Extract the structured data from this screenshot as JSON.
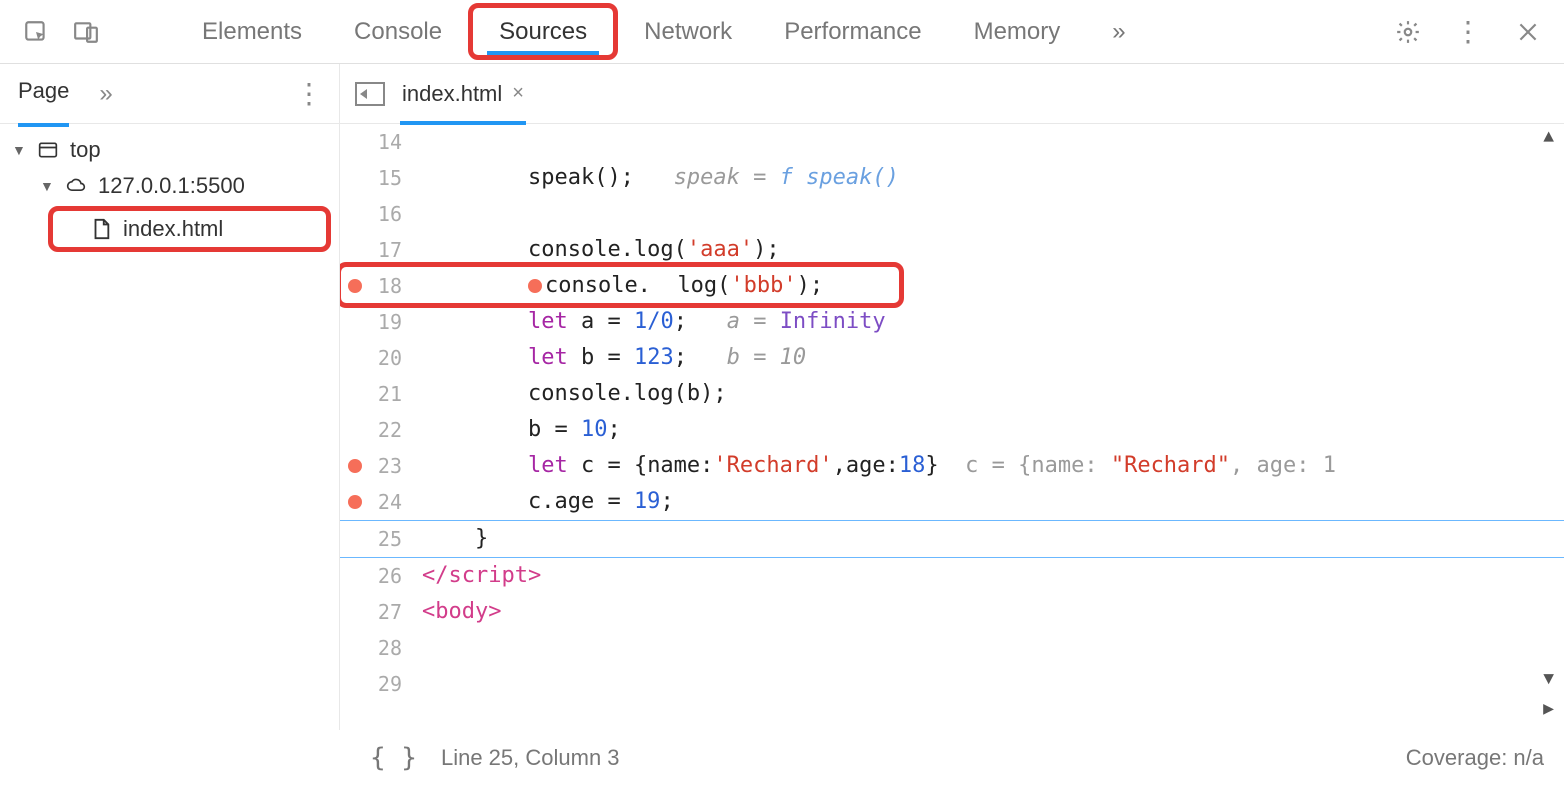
{
  "topTabs": {
    "elements": "Elements",
    "console": "Console",
    "sources": "Sources",
    "network": "Network",
    "performance": "Performance",
    "memory": "Memory",
    "more": "»"
  },
  "navigator": {
    "tab": "Page",
    "more": "»",
    "top": "top",
    "host": "127.0.0.1:5500",
    "file": "index.html"
  },
  "editor": {
    "tab": "index.html",
    "closeGlyph": "×",
    "lines": {
      "14": "14",
      "15": "15",
      "16": "16",
      "17": "17",
      "18": "18",
      "19": "19",
      "20": "20",
      "21": "21",
      "22": "22",
      "23": "23",
      "24": "24",
      "25": "25",
      "26": "26",
      "27": "27",
      "28": "28",
      "29": "29"
    },
    "code": {
      "l15_call": "speak();",
      "l15_hint_prefix": "speak = ",
      "l15_hint_fn": "f speak()",
      "l17": "console.log(",
      "l17_str": "'aaa'",
      "l17_end": ");",
      "l18a": "console.",
      "l18b": "log(",
      "l18_str": "'bbb'",
      "l18_end": ");",
      "l19_let": "let",
      "l19_a": " a = ",
      "l19_expr": "1/0",
      "l19_semi": ";",
      "l19_hint": "a = ",
      "l19_inf": "Infinity",
      "l20_let": "let",
      "l20_b": " b = ",
      "l20_num": "123",
      "l20_semi": ";",
      "l20_hint": "b = 10",
      "l21": "console.log(b);",
      "l22": "b = ",
      "l22_num": "10",
      "l22_semi": ";",
      "l23_let": "let",
      "l23_c": " c = {name:",
      "l23_str": "'Rechard'",
      "l23_c2": ",age:",
      "l23_age": "18",
      "l23_c3": "}",
      "l23_hint": "c = {name: ",
      "l23_hstr": "\"Rechard\"",
      "l23_h2": ", age: 1",
      "l24": "c.age = ",
      "l24_num": "19",
      "l24_semi": ";",
      "l25": "}",
      "l26": "</script​>",
      "l27": "<body>"
    }
  },
  "status": {
    "braces": "{ }",
    "position": "Line 25, Column 3",
    "coverage": "Coverage: n/a"
  }
}
